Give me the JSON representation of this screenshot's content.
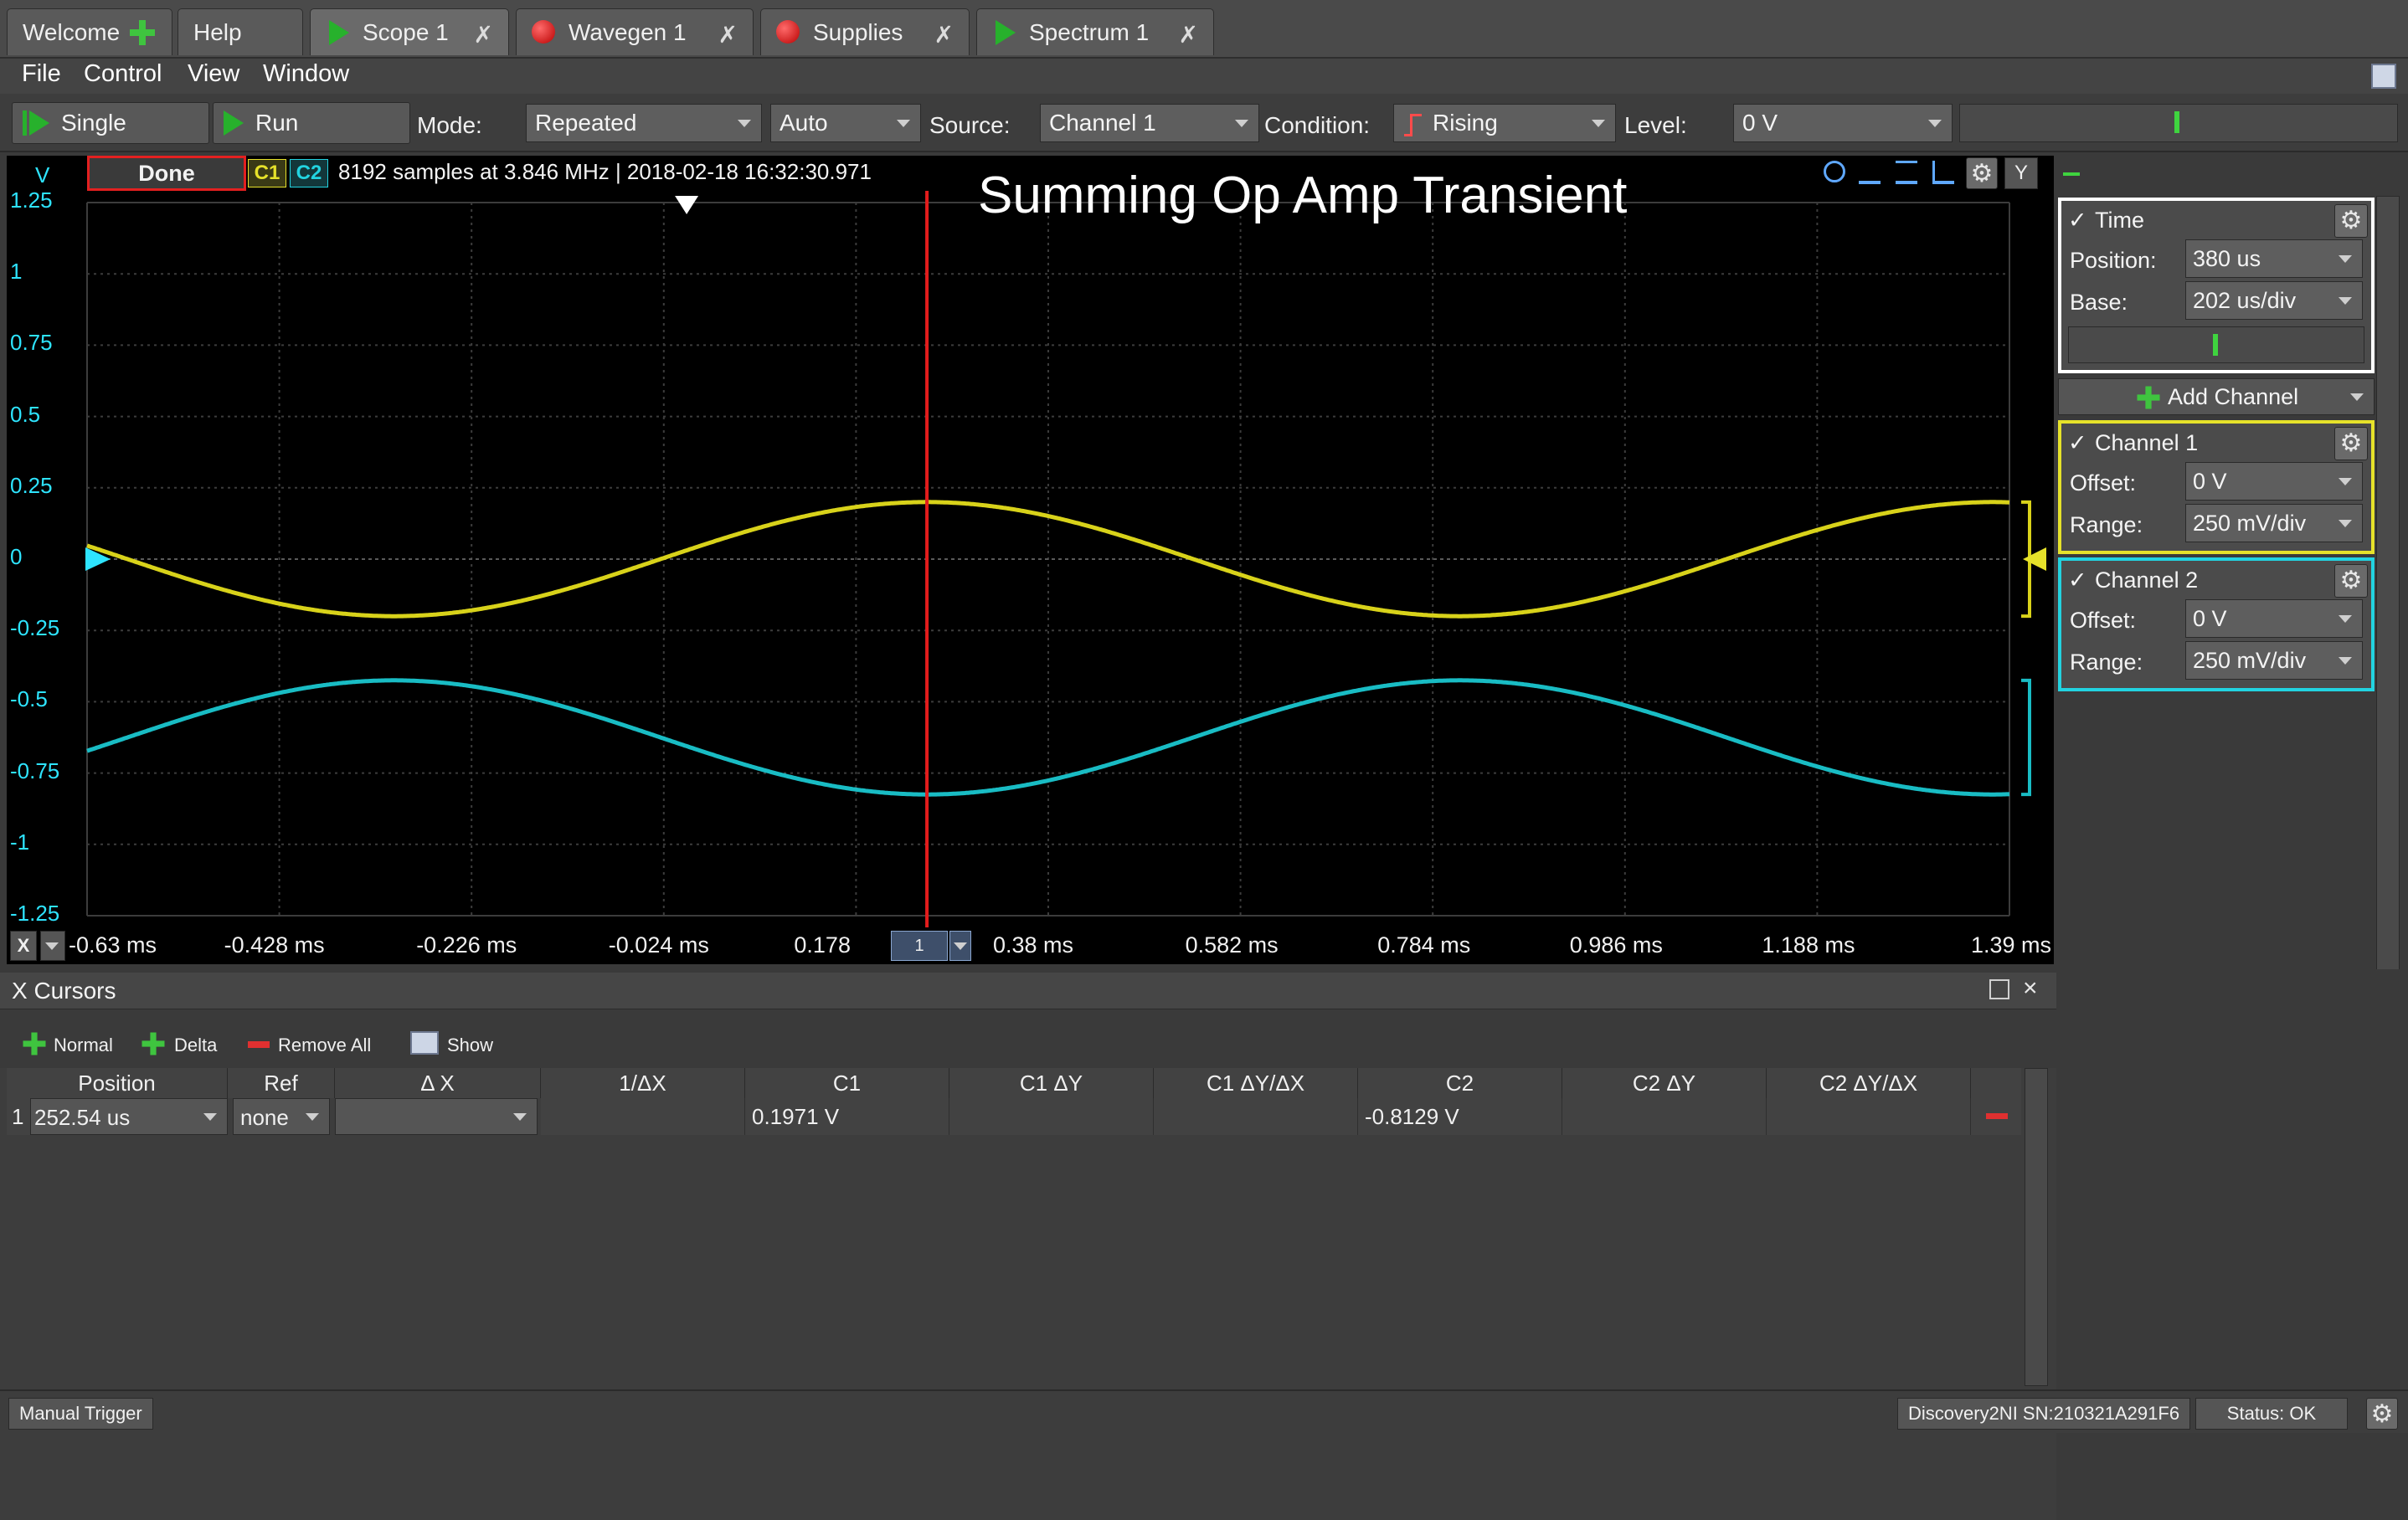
{
  "tabs": [
    {
      "label": "Welcome",
      "icon": "plus-icon"
    },
    {
      "label": "Help"
    },
    {
      "label": "Scope 1",
      "icon": "play-icon",
      "closable": true
    },
    {
      "label": "Wavegen 1",
      "icon": "stop-icon",
      "closable": true
    },
    {
      "label": "Supplies",
      "icon": "stop-icon",
      "closable": true
    },
    {
      "label": "Spectrum 1",
      "icon": "play-icon",
      "closable": true
    }
  ],
  "close_glyph": "✗",
  "menu": {
    "file": "File",
    "control": "Control",
    "view": "View",
    "window": "Window"
  },
  "toolbar": {
    "single": "Single",
    "run": "Run",
    "mode_label": "Mode:",
    "mode_value": "Repeated",
    "auto_value": "Auto",
    "source_label": "Source:",
    "source_value": "Channel 1",
    "condition_label": "Condition:",
    "condition_value": "Rising",
    "level_label": "Level:",
    "level_value": "0 V"
  },
  "plot": {
    "y_unit": "V",
    "status": "Done",
    "c1": "C1",
    "c2": "C2",
    "info": "8192 samples at 3.846 MHz | 2018-02-18 16:32:30.971",
    "title": "Summing Op Amp Transient",
    "y_button": "Y",
    "x_button": "X",
    "cursor_label": "1",
    "x_tick_values": [
      "-0.63 ms",
      "-0.428 ms",
      "-0.226 ms",
      "-0.024 ms",
      "0.178",
      "0.38 ms",
      "0.582 ms",
      "0.784 ms",
      "0.986 ms",
      "1.188 ms",
      "1.39 ms"
    ],
    "y_tick_values": [
      "1.25",
      "1",
      "0.75",
      "0.5",
      "0.25",
      "0",
      "-0.25",
      "-0.5",
      "-0.75",
      "-1",
      "-1.25"
    ]
  },
  "chart_data": {
    "type": "line",
    "title": "Summing Op Amp Transient",
    "xlabel": "",
    "ylabel": "V",
    "x_unit": "ms",
    "xlim": [
      -0.63,
      1.39
    ],
    "ylim": [
      -1.25,
      1.25
    ],
    "grid": true,
    "cursor_x_ms": 0.2525,
    "series": [
      {
        "name": "C1",
        "color": "#d8d21a",
        "offset": 0.0,
        "amplitude": 0.2,
        "period_ms": 1.12,
        "peak_at_ms": 0.2525
      },
      {
        "name": "C2",
        "color": "#19bcc4",
        "offset": -0.625,
        "amplitude": 0.2,
        "period_ms": 1.12,
        "trough_at_ms": 0.2525
      }
    ]
  },
  "time_panel": {
    "title": "Time",
    "position_label": "Position:",
    "position_value": "380 us",
    "base_label": "Base:",
    "base_value": "202 us/div"
  },
  "add_channel": "Add Channel",
  "channel1": {
    "title": "Channel 1",
    "offset_label": "Offset:",
    "offset_value": "0 V",
    "range_label": "Range:",
    "range_value": "250 mV/div",
    "color": "#e6e22a"
  },
  "channel2": {
    "title": "Channel 2",
    "offset_label": "Offset:",
    "offset_value": "0 V",
    "range_label": "Range:",
    "range_value": "250 mV/div",
    "color": "#22d3e0"
  },
  "cursors": {
    "title": "X Cursors",
    "normal": "Normal",
    "delta": "Delta",
    "remove_all": "Remove All",
    "show": "Show",
    "columns": [
      "Position",
      "Ref",
      "Δ X",
      "1/ΔX",
      "C1",
      "C1 ΔY",
      "C1 ΔY/ΔX",
      "C2",
      "C2 ΔY",
      "C2 ΔY/ΔX"
    ],
    "row": {
      "index": "1",
      "position": "252.54 us",
      "ref": "none",
      "c1": "0.1971 V",
      "c2": "-0.8129 V"
    }
  },
  "status": {
    "manual_trigger": "Manual Trigger",
    "device": "Discovery2NI SN:210321A291F6",
    "status": "Status: OK"
  }
}
